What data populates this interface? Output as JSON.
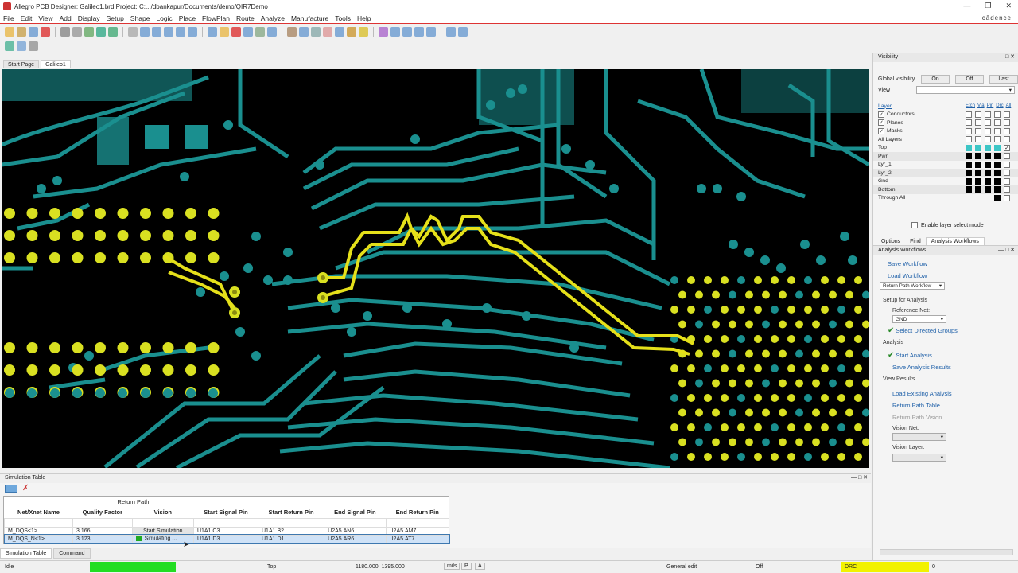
{
  "window": {
    "title": "Allegro PCB Designer: Galileo1.brd  Project: C:.../dbankapur/Documents/demo/QIR7Demo",
    "brand": "cādence"
  },
  "menu": [
    "File",
    "Edit",
    "View",
    "Add",
    "Display",
    "Setup",
    "Shape",
    "Logic",
    "Place",
    "FlowPlan",
    "Route",
    "Analyze",
    "Manufacture",
    "Tools",
    "Help"
  ],
  "tabs": [
    "Start Page",
    "Galileo1"
  ],
  "visibility": {
    "title": "Visibility",
    "global_label": "Global visibility",
    "on": "On",
    "off": "Off",
    "last": "Last",
    "view_label": "View",
    "layer_header": "Layer",
    "col_heads": [
      "Etch",
      "Via",
      "Pin",
      "Drc",
      "All"
    ],
    "groups": [
      "Conductors",
      "Planes",
      "Masks",
      "All Layers"
    ],
    "layers": [
      "Top",
      "Pwr",
      "Lyr_1",
      "Lyr_2",
      "Gnd",
      "Bottom",
      "Through All"
    ],
    "enable_label": "Enable layer select mode"
  },
  "panel_tabs": [
    "Options",
    "Find",
    "Analysis Workflows"
  ],
  "workflows": {
    "title": "Analysis Workflows",
    "save": "Save Workflow",
    "load": "Load Workflow",
    "workflow_select": "Return Path Workflow",
    "setup_head": "Setup for Analysis",
    "ref_net_label": "Reference Net:",
    "ref_net": "GND",
    "select_groups": "Select Directed Groups",
    "analysis_head": "Analysis",
    "start": "Start Analysis",
    "save_results": "Save Analysis Results",
    "view_head": "View Results",
    "load_existing": "Load Existing Analysis",
    "rp_table": "Return Path Table",
    "rp_vision": "Return Path Vision",
    "vision_net": "Vision Net:",
    "vision_layer": "Vision Layer:"
  },
  "simtable": {
    "title": "Simulation Table",
    "group_header": "Return Path",
    "headers": [
      "Net/Xnet Name",
      "Quality Factor",
      "Vision",
      "Start Signal Pin",
      "Start Return Pin",
      "End Signal Pin",
      "End Return Pin"
    ],
    "rows": [
      [
        "M_DQS<1>",
        "3.166",
        "Start Simulation",
        "U1A1.C3",
        "U1A1.B2",
        "U2A5.AN6",
        "U2A5.AM7"
      ],
      [
        "M_DQS_N<1>",
        "3.123",
        "Simulating ...",
        "U1A1.D3",
        "U1A1.D1",
        "U2A5.AR6",
        "U2A5.AT7"
      ]
    ]
  },
  "bottom_tabs": [
    "Simulation Table",
    "Command"
  ],
  "status": {
    "mode": "Idle",
    "layer": "Top",
    "coords": "1180.000, 1395.000",
    "units": "mils",
    "p": "P",
    "a": "A",
    "edit": "General edit",
    "off": "Off",
    "drc": "DRC",
    "drc_count": "0"
  },
  "colors": {
    "trace": "#1a8f8f",
    "pad": "#d9e021",
    "highlight": "#e5e01a",
    "drc": "#f2f200",
    "progress": "#22dd22"
  }
}
